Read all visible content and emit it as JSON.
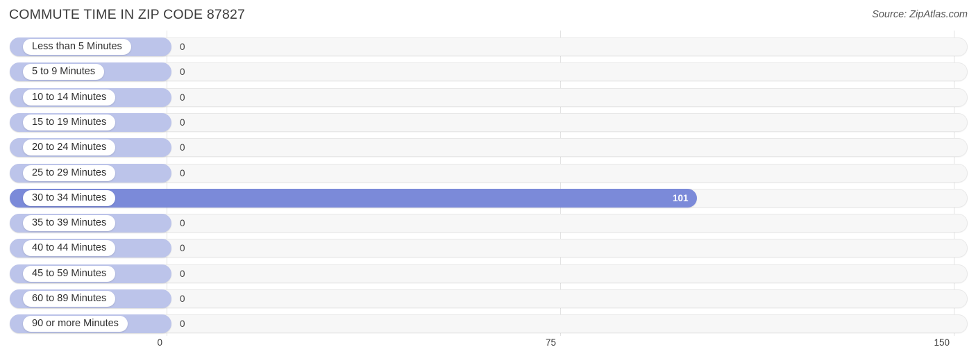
{
  "header": {
    "title": "COMMUTE TIME IN ZIP CODE 87827",
    "source": "Source: ZipAtlas.com"
  },
  "colors": {
    "bar_zero": "#bcc4ea",
    "bar_active": "#7b8ad9",
    "track": "#f7f7f7",
    "gridline": "#e3e3e3",
    "title_text": "#3c3c3c"
  },
  "chart_data": {
    "type": "bar",
    "orientation": "horizontal",
    "title": "COMMUTE TIME IN ZIP CODE 87827",
    "xlabel": "",
    "ylabel": "",
    "xlim": [
      0,
      150
    ],
    "grid": true,
    "legend": false,
    "source": "Source: ZipAtlas.com",
    "axis_ticks": [
      "0",
      "75",
      "150"
    ],
    "axis_tick_values": [
      0,
      75,
      150
    ],
    "categories": [
      "Less than 5 Minutes",
      "5 to 9 Minutes",
      "10 to 14 Minutes",
      "15 to 19 Minutes",
      "20 to 24 Minutes",
      "25 to 29 Minutes",
      "30 to 34 Minutes",
      "35 to 39 Minutes",
      "40 to 44 Minutes",
      "45 to 59 Minutes",
      "60 to 89 Minutes",
      "90 or more Minutes"
    ],
    "values": [
      0,
      0,
      0,
      0,
      0,
      0,
      101,
      0,
      0,
      0,
      0,
      0
    ],
    "value_labels": [
      "0",
      "0",
      "0",
      "0",
      "0",
      "0",
      "101",
      "0",
      "0",
      "0",
      "0",
      "0"
    ]
  },
  "rows": [
    {
      "label": "Less than 5 Minutes",
      "value": 0,
      "value_label": "0"
    },
    {
      "label": "5 to 9 Minutes",
      "value": 0,
      "value_label": "0"
    },
    {
      "label": "10 to 14 Minutes",
      "value": 0,
      "value_label": "0"
    },
    {
      "label": "15 to 19 Minutes",
      "value": 0,
      "value_label": "0"
    },
    {
      "label": "20 to 24 Minutes",
      "value": 0,
      "value_label": "0"
    },
    {
      "label": "25 to 29 Minutes",
      "value": 0,
      "value_label": "0"
    },
    {
      "label": "30 to 34 Minutes",
      "value": 101,
      "value_label": "101"
    },
    {
      "label": "35 to 39 Minutes",
      "value": 0,
      "value_label": "0"
    },
    {
      "label": "40 to 44 Minutes",
      "value": 0,
      "value_label": "0"
    },
    {
      "label": "45 to 59 Minutes",
      "value": 0,
      "value_label": "0"
    },
    {
      "label": "60 to 89 Minutes",
      "value": 0,
      "value_label": "0"
    },
    {
      "label": "90 or more Minutes",
      "value": 0,
      "value_label": "0"
    }
  ]
}
